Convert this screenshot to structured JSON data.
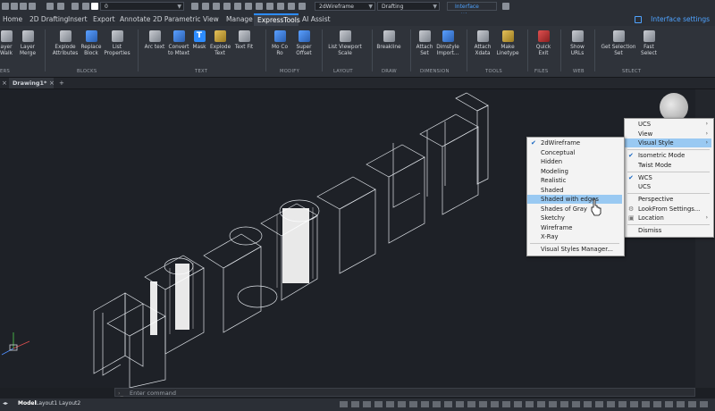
{
  "quick_access": {
    "layer_value": "0",
    "visual_style_value": "2dWireframe",
    "workspace_value": "Drafting",
    "interface_settings": "Interface settings"
  },
  "menu_tabs": [
    "Home",
    "2D Drafting",
    "Insert",
    "Export",
    "Annotate",
    "2D Parametric",
    "View",
    "Manage",
    "ExpressTools",
    "AI Assist"
  ],
  "active_tab": "ExpressTools",
  "interface_settings_label": "Interface settings",
  "ribbon": {
    "buttons": [
      {
        "label": "ayer Walk"
      },
      {
        "label": "Layer Merge"
      },
      {
        "label": "Explode Attributes"
      },
      {
        "label": "Replace Block"
      },
      {
        "label": "List Properties"
      },
      {
        "label": "Arc text"
      },
      {
        "label": "Convert to Mtext"
      },
      {
        "label": "Mask"
      },
      {
        "label": "Explode Text"
      },
      {
        "label": "Text Fit"
      },
      {
        "label": "Mo Co Ro"
      },
      {
        "label": "Super Offset"
      },
      {
        "label": "List Viewport Scale"
      },
      {
        "label": "Breakline"
      },
      {
        "label": "Attach Set"
      },
      {
        "label": "Dimstyle Import..."
      },
      {
        "label": "Attach Xdata"
      },
      {
        "label": "Make Linetype"
      },
      {
        "label": "Quick Exit"
      },
      {
        "label": "Show URLs"
      },
      {
        "label": "Get Selection Set"
      },
      {
        "label": "Fast Select"
      }
    ],
    "groups": [
      "ERS",
      "BLOCKS",
      "TEXT",
      "MODIFY",
      "LAYOUT",
      "DRAW",
      "DIMENSION",
      "TOOLS",
      "FILES",
      "WEB",
      "SELECT"
    ]
  },
  "doc_tab": "Drawing1*",
  "visual_style_menu": {
    "items": [
      {
        "label": "2dWireframe",
        "checked": true
      },
      {
        "label": "Conceptual"
      },
      {
        "label": "Hidden"
      },
      {
        "label": "Modeling"
      },
      {
        "label": "Realistic"
      },
      {
        "label": "Shaded"
      },
      {
        "label": "Shaded with edges",
        "highlighted": true
      },
      {
        "label": "Shades of Gray"
      },
      {
        "label": "Sketchy"
      },
      {
        "label": "Wireframe"
      },
      {
        "label": "X-Ray"
      },
      {
        "label": "Visual Styles Manager..."
      }
    ]
  },
  "view_menu": {
    "items": [
      {
        "label": "UCS",
        "submenu": true
      },
      {
        "label": "View",
        "submenu": true
      },
      {
        "label": "Visual Style",
        "submenu": true,
        "highlighted": true
      },
      {
        "label": "Isometric Mode",
        "checked": true
      },
      {
        "label": "Twist Mode"
      },
      {
        "label": "WCS",
        "checked": true
      },
      {
        "label": "UCS"
      },
      {
        "label": "Perspective"
      },
      {
        "label": "LookFrom Settings..."
      },
      {
        "label": "Location",
        "submenu": true
      },
      {
        "label": "Dismiss"
      }
    ]
  },
  "command_placeholder": "Enter command",
  "layout_tabs": [
    "Model",
    "Layout1",
    "Layout2"
  ],
  "colors": {
    "accent": "#2d8cff",
    "highlight": "#99c9f2",
    "menu_bg": "#f3f3f3"
  }
}
